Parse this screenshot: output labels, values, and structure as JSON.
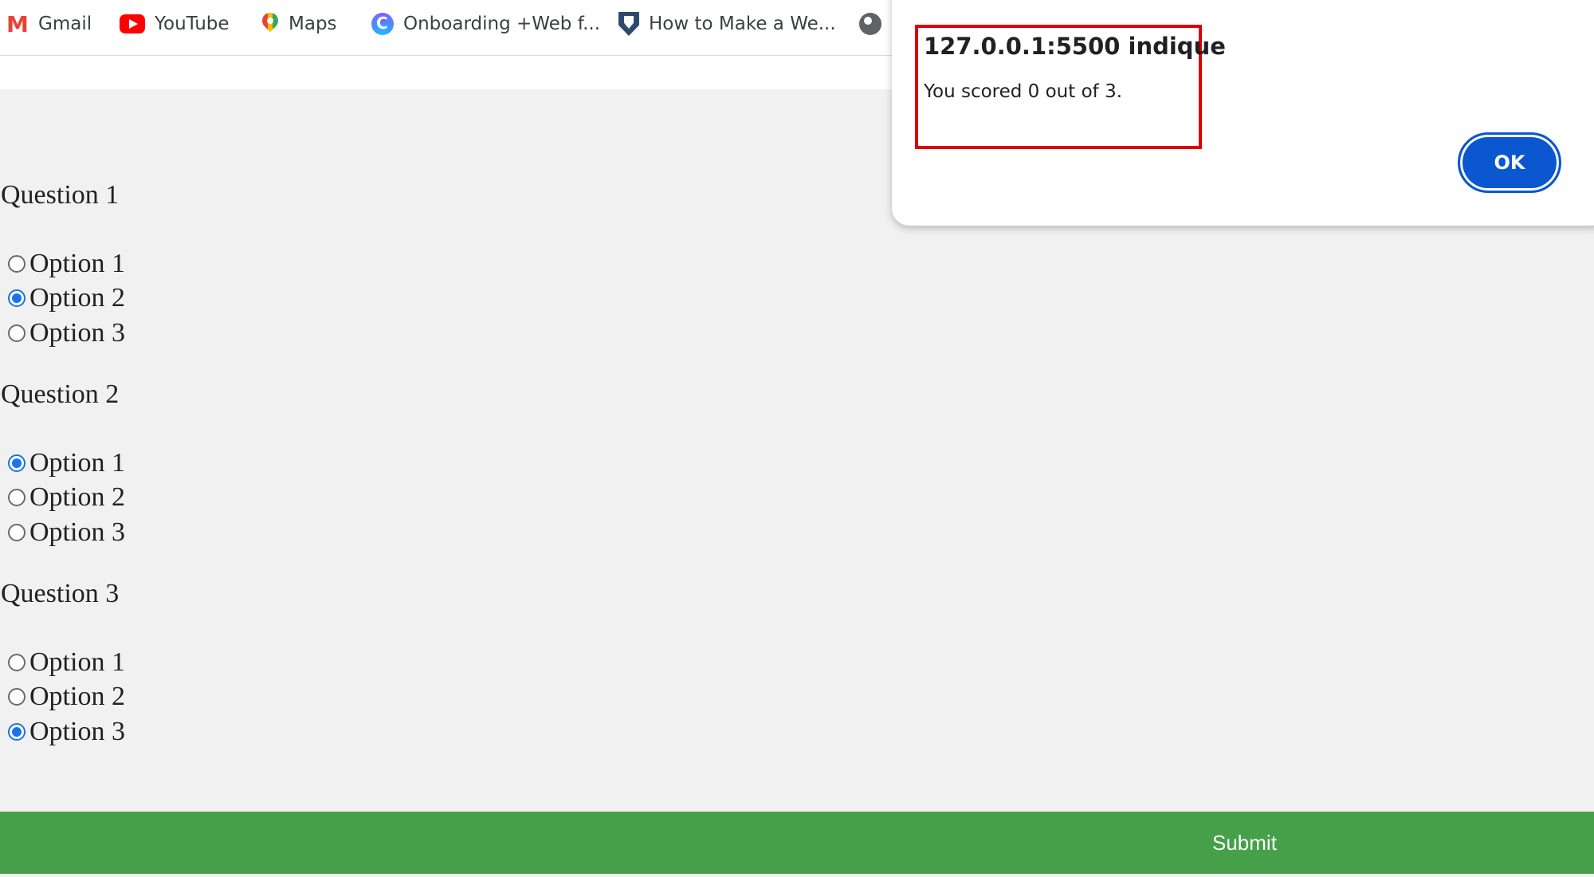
{
  "bookmarks": [
    {
      "label": "Gmail",
      "icon": "gmail-icon"
    },
    {
      "label": "YouTube",
      "icon": "youtube-icon"
    },
    {
      "label": "Maps",
      "icon": "maps-pin-icon"
    },
    {
      "label": "Onboarding +Web f...",
      "icon": "onboarding-icon"
    },
    {
      "label": "How to Make a We...",
      "icon": "shield-icon"
    },
    {
      "label": "",
      "icon": "globe-icon"
    }
  ],
  "quiz": {
    "questions": [
      {
        "title": "Question 1",
        "options": [
          "Option 1",
          "Option 2",
          "Option 3"
        ],
        "selected": 2
      },
      {
        "title": "Question 2",
        "options": [
          "Option 1",
          "Option 2",
          "Option 3"
        ],
        "selected": 1
      },
      {
        "title": "Question 3",
        "options": [
          "Option 1",
          "Option 2",
          "Option 3"
        ],
        "selected": 3
      }
    ],
    "submit_label": "Submit"
  },
  "dialog": {
    "title": "127.0.0.1:5500 indique",
    "message": "You scored 0 out of 3.",
    "ok_label": "OK"
  },
  "colors": {
    "accent": "#1a73e8",
    "submit_bar": "#46a049",
    "ok_button": "#0b57d0",
    "highlight": "#e00000",
    "page_background": "#f1f1f1"
  }
}
